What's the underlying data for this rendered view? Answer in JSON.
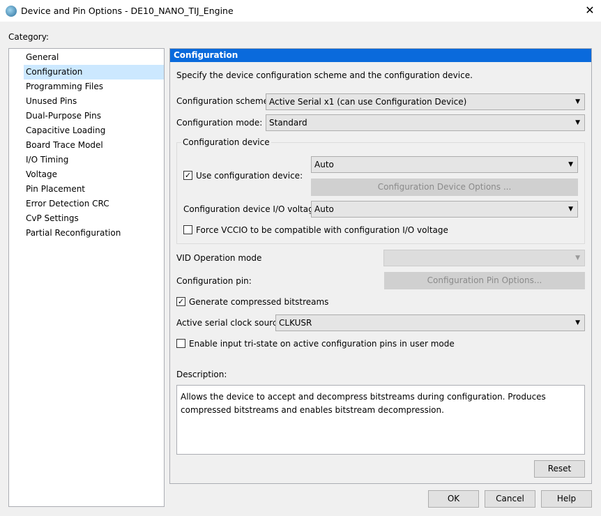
{
  "window": {
    "title": "Device and Pin Options - DE10_NANO_TIJ_Engine",
    "close": "✕"
  },
  "category_label": "Category:",
  "categories": [
    "General",
    "Configuration",
    "Programming Files",
    "Unused Pins",
    "Dual-Purpose Pins",
    "Capacitive Loading",
    "Board Trace Model",
    "I/O Timing",
    "Voltage",
    "Pin Placement",
    "Error Detection CRC",
    "CvP Settings",
    "Partial Reconfiguration"
  ],
  "panel": {
    "header": "Configuration",
    "intro": "Specify the device configuration scheme and the configuration device.",
    "scheme_label": "Configuration scheme:",
    "scheme_value": "Active Serial x1 (can use Configuration Device)",
    "mode_label": "Configuration mode:",
    "mode_value": "Standard",
    "group_title": "Configuration device",
    "use_device_label": "Use configuration device:",
    "use_device_checked": true,
    "use_device_value": "Auto",
    "device_options_button": "Configuration Device Options ...",
    "io_voltage_label": "Configuration device I/O voltage:",
    "io_voltage_value": "Auto",
    "force_vccio_label": "Force VCCIO to be compatible with configuration I/O voltage",
    "force_vccio_checked": false,
    "vid_label": "VID Operation mode",
    "vid_value": "",
    "pin_label": "Configuration pin:",
    "pin_button": "Configuration Pin Options...",
    "compress_label": "Generate compressed bitstreams",
    "compress_checked": true,
    "clock_label": "Active serial clock source:",
    "clock_value": "CLKUSR",
    "tristate_label": "Enable input tri-state on active configuration pins in user mode",
    "tristate_checked": false,
    "description_label": "Description:",
    "description_text": "Allows the device to accept and decompress bitstreams during configuration. Produces compressed bitstreams and enables bitstream decompression.",
    "reset_button": "Reset"
  },
  "buttons": {
    "ok": "OK",
    "cancel": "Cancel",
    "help": "Help"
  },
  "check_mark": "✓",
  "arrow": "▼"
}
